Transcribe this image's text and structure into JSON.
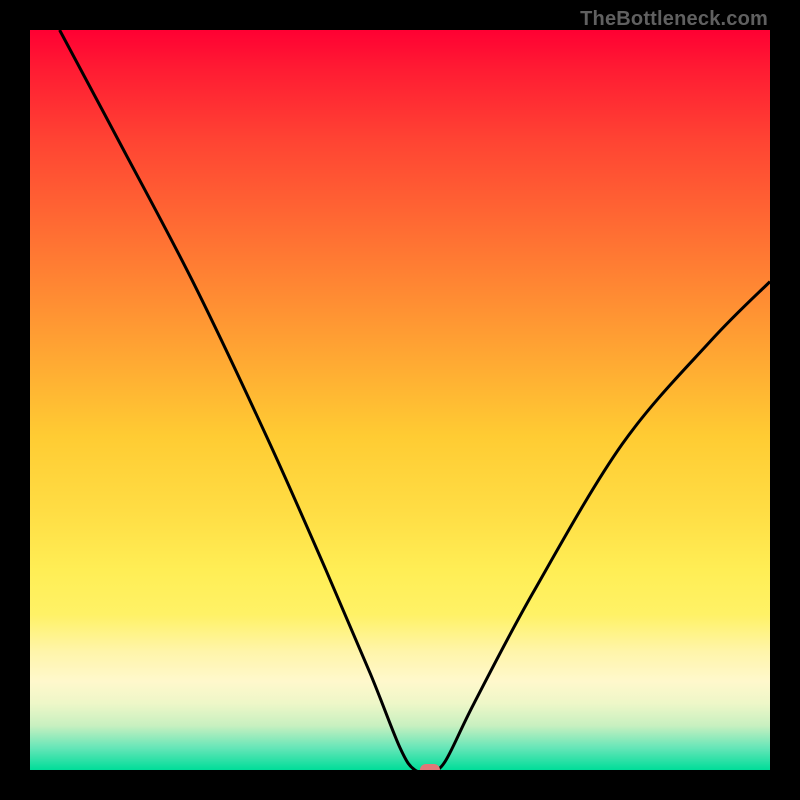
{
  "credit_text": "TheBottleneck.com",
  "chart_data": {
    "type": "line",
    "title": "",
    "xlabel": "",
    "ylabel": "",
    "xlim": [
      0,
      100
    ],
    "ylim": [
      0,
      100
    ],
    "series": [
      {
        "name": "bottleneck-curve",
        "x": [
          4,
          12,
          22,
          32,
          40,
          46,
          50,
          52,
          54,
          56,
          60,
          68,
          80,
          92,
          100
        ],
        "values": [
          100,
          85,
          66,
          45,
          27,
          13,
          3,
          0,
          0,
          1,
          9,
          24,
          44,
          58,
          66
        ]
      }
    ],
    "annotations": [
      {
        "name": "selected-point",
        "x": 54,
        "y": 0
      }
    ],
    "gradient": {
      "top_color": "#ff0033",
      "bottom_color": "#00dd99",
      "meaning": "red=high bottleneck, green=low bottleneck"
    }
  }
}
